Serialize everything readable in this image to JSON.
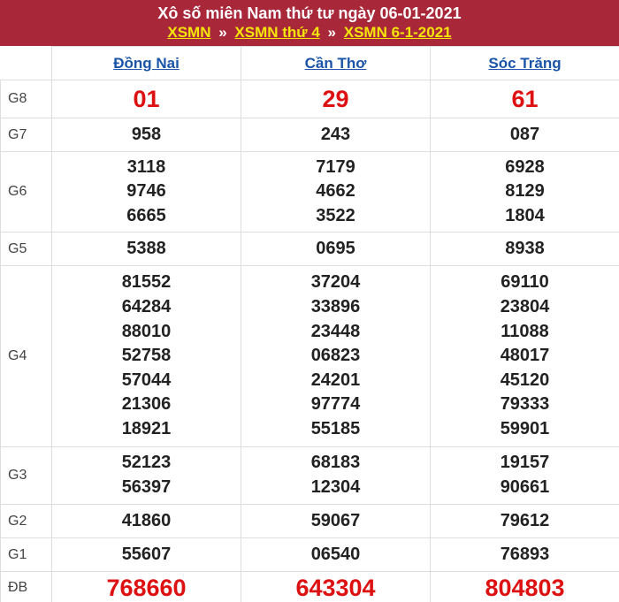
{
  "header": {
    "title": "Xô số miên Nam thứ tư ngày 06-01-2021",
    "crumbs": [
      "XSMN",
      "XSMN thứ 4",
      "XSMN 6-1-2021"
    ],
    "separator": "»"
  },
  "provinces": [
    "Đồng Nai",
    "Cần Thơ",
    "Sóc Trăng"
  ],
  "rows": [
    {
      "label": "G8",
      "values": [
        [
          "01"
        ],
        [
          "29"
        ],
        [
          "61"
        ]
      ]
    },
    {
      "label": "G7",
      "values": [
        [
          "958"
        ],
        [
          "243"
        ],
        [
          "087"
        ]
      ]
    },
    {
      "label": "G6",
      "values": [
        [
          "3118",
          "9746",
          "6665"
        ],
        [
          "7179",
          "4662",
          "3522"
        ],
        [
          "6928",
          "8129",
          "1804"
        ]
      ]
    },
    {
      "label": "G5",
      "values": [
        [
          "5388"
        ],
        [
          "0695"
        ],
        [
          "8938"
        ]
      ]
    },
    {
      "label": "G4",
      "values": [
        [
          "81552",
          "64284",
          "88010",
          "52758",
          "57044",
          "21306",
          "18921"
        ],
        [
          "37204",
          "33896",
          "23448",
          "06823",
          "24201",
          "97774",
          "55185"
        ],
        [
          "69110",
          "23804",
          "11088",
          "48017",
          "45120",
          "79333",
          "59901"
        ]
      ]
    },
    {
      "label": "G3",
      "values": [
        [
          "52123",
          "56397"
        ],
        [
          "68183",
          "12304"
        ],
        [
          "19157",
          "90661"
        ]
      ]
    },
    {
      "label": "G2",
      "values": [
        [
          "41860"
        ],
        [
          "59067"
        ],
        [
          "79612"
        ]
      ]
    },
    {
      "label": "G1",
      "values": [
        [
          "55607"
        ],
        [
          "06540"
        ],
        [
          "76893"
        ]
      ]
    },
    {
      "label": "ĐB",
      "values": [
        [
          "768660"
        ],
        [
          "643304"
        ],
        [
          "804803"
        ]
      ]
    }
  ],
  "colors": {
    "header_bg": "#a8283a",
    "crumb_link": "#f5e60a",
    "province_link": "#1b55a8",
    "highlight": "#dd1111"
  }
}
